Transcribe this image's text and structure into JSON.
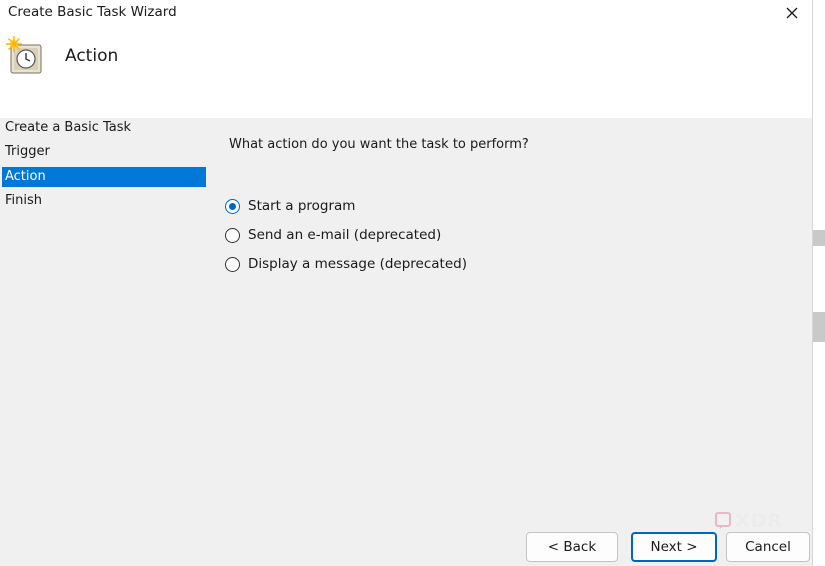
{
  "window": {
    "title": "Create Basic Task Wizard"
  },
  "header": {
    "title": "Action",
    "icon": "task-scheduler-clock-icon"
  },
  "sidebar": {
    "steps": [
      {
        "label": "Create a Basic Task",
        "active": false
      },
      {
        "label": "Trigger",
        "active": false
      },
      {
        "label": "Action",
        "active": true
      },
      {
        "label": "Finish",
        "active": false
      }
    ]
  },
  "main": {
    "question": "What action do you want the task to perform?",
    "options": [
      {
        "label": "Start a program",
        "checked": true
      },
      {
        "label": "Send an e-mail (deprecated)",
        "checked": false
      },
      {
        "label": "Display a message (deprecated)",
        "checked": false
      }
    ]
  },
  "buttons": {
    "back": "< Back",
    "next": "Next >",
    "cancel": "Cancel"
  },
  "watermark": {
    "text": "XDR"
  },
  "colors": {
    "accent": "#0078d7",
    "radio_accent": "#0067c0",
    "panel_bg": "#f0f0f0"
  }
}
